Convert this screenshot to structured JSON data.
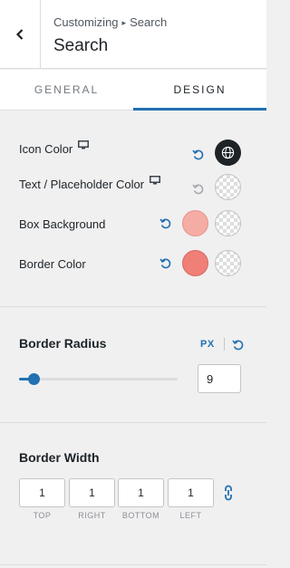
{
  "header": {
    "breadcrumb_parent": "Customizing",
    "breadcrumb_sep": "▸",
    "breadcrumb_current": "Search",
    "title": "Search"
  },
  "tabs": [
    {
      "label": "GENERAL",
      "active": false
    },
    {
      "label": "DESIGN",
      "active": true
    }
  ],
  "colors": {
    "rows": [
      {
        "label": "Icon Color",
        "responsive": true
      },
      {
        "label": "Text / Placeholder Color",
        "responsive": true
      },
      {
        "label": "Box Background",
        "responsive": false
      },
      {
        "label": "Border Color",
        "responsive": false
      }
    ],
    "icon_color": "#1d2327",
    "box_background": "#f4ada4",
    "border_color": "#ef7f77",
    "accent": "#2271b1"
  },
  "border_radius": {
    "title": "Border Radius",
    "unit": "PX",
    "value": "9",
    "slider_fraction": 0.09
  },
  "border_width": {
    "title": "Border Width",
    "sides": [
      {
        "label": "TOP",
        "value": "1"
      },
      {
        "label": "RIGHT",
        "value": "1"
      },
      {
        "label": "BOTTOM",
        "value": "1"
      },
      {
        "label": "LEFT",
        "value": "1"
      }
    ]
  }
}
